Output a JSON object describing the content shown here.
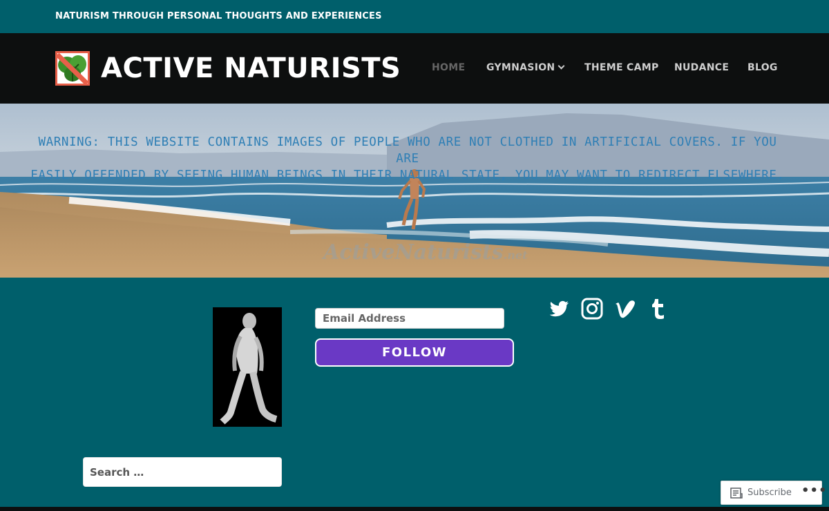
{
  "top": {
    "tagline": "NATURISM THROUGH PERSONAL THOUGHTS AND EXPERIENCES"
  },
  "header": {
    "site_title": "ACTIVE NATURISTS",
    "logo_icon": "leaf-no-sign-icon",
    "nav": [
      {
        "label": "HOME",
        "current": true
      },
      {
        "label": "GYMNASION",
        "has_dropdown": true
      },
      {
        "label": "THEME CAMP"
      },
      {
        "label": "NUDANCE"
      },
      {
        "label": "BLOG"
      }
    ]
  },
  "hero": {
    "warning_line1": "Warning: This website contains images of people who are not clothed in artificial covers. If you are",
    "warning_line2": "easily offended by seeing human beings in their natural state, you may want to redirect elsewhere.",
    "watermark": "ActiveNaturists",
    "watermark_tld": ".net"
  },
  "widgets": {
    "email_placeholder": "Email Address",
    "follow_label": "FOLLOW",
    "social": [
      "twitter-icon",
      "instagram-icon",
      "vimeo-icon",
      "tumblr-icon"
    ],
    "search_placeholder": "Search …"
  },
  "subscribe": {
    "label": "Subscribe",
    "more": "•••"
  },
  "colors": {
    "teal_background": "#005f6b",
    "header_black": "#0d0f0f",
    "follow_purple": "#6a39c5",
    "warning_blue": "#2f7fb5"
  }
}
